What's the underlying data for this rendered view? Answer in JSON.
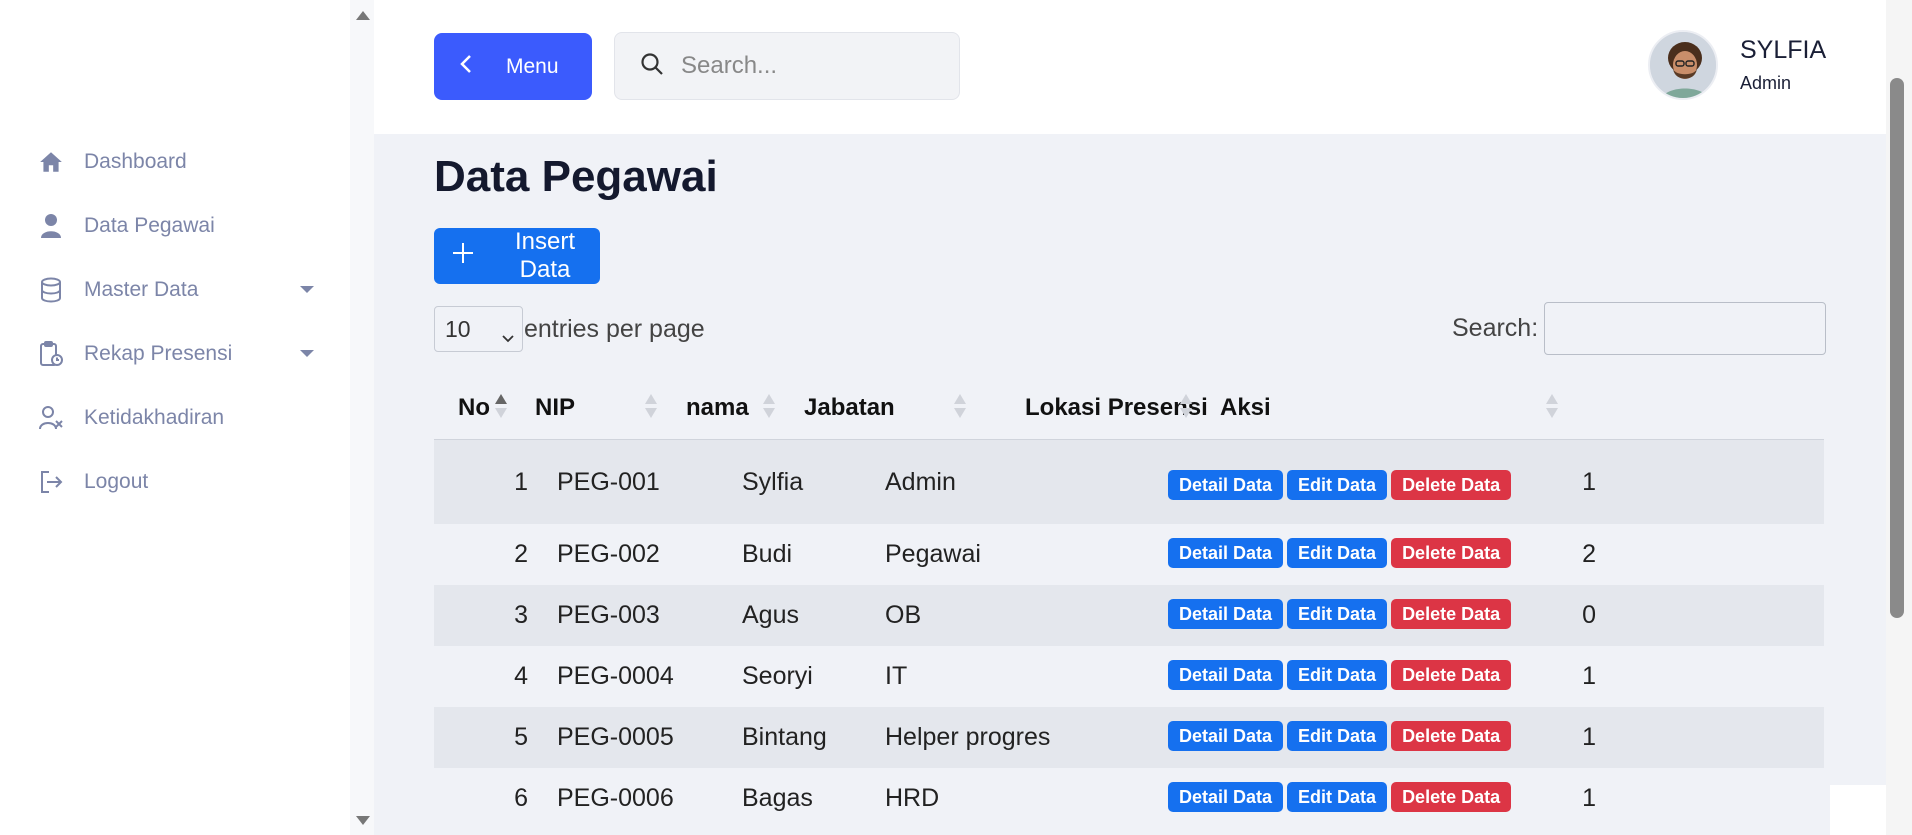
{
  "sidebar": {
    "items": [
      {
        "label": "Dashboard",
        "icon": "home-icon"
      },
      {
        "label": "Data Pegawai",
        "icon": "user-icon"
      },
      {
        "label": "Master Data",
        "icon": "database-icon"
      },
      {
        "label": "Rekap Presensi",
        "icon": "clipboard-clock-icon"
      },
      {
        "label": "Ketidakhadiran",
        "icon": "user-x-icon"
      },
      {
        "label": "Logout",
        "icon": "logout-icon"
      }
    ]
  },
  "header": {
    "menu_label": "Menu",
    "search_placeholder": "Search...",
    "user_name": "SYLFIA",
    "user_role": "Admin"
  },
  "page": {
    "title": "Data Pegawai",
    "insert_label": "Insert Data",
    "entries_value": "10",
    "entries_label": "entries per page",
    "search_label": "Search:"
  },
  "table": {
    "columns": [
      "No",
      "NIP",
      "nama",
      "Jabatan",
      "Lokasi Presensi",
      "Aksi"
    ],
    "rows": [
      {
        "no": "1",
        "nip": "PEG-001",
        "nama": "Sylfia",
        "jabatan": "Admin",
        "lokasi": "1"
      },
      {
        "no": "2",
        "nip": "PEG-002",
        "nama": "Budi",
        "jabatan": "Pegawai",
        "lokasi": "2"
      },
      {
        "no": "3",
        "nip": "PEG-003",
        "nama": "Agus",
        "jabatan": "OB",
        "lokasi": "0"
      },
      {
        "no": "4",
        "nip": "PEG-0004",
        "nama": "Seoryi",
        "jabatan": "IT",
        "lokasi": "1"
      },
      {
        "no": "5",
        "nip": "PEG-0005",
        "nama": "Bintang",
        "jabatan": "Helper progres",
        "lokasi": "1"
      },
      {
        "no": "6",
        "nip": "PEG-0006",
        "nama": "Bagas",
        "jabatan": "HRD",
        "lokasi": "1"
      }
    ],
    "actions": {
      "detail": "Detail Data",
      "edit": "Edit Data",
      "delete": "Delete Data"
    }
  },
  "colors": {
    "primary": "#3b5bfd",
    "blue": "#1570ef",
    "danger": "#dc3545",
    "nav_text": "#7c85a8"
  }
}
